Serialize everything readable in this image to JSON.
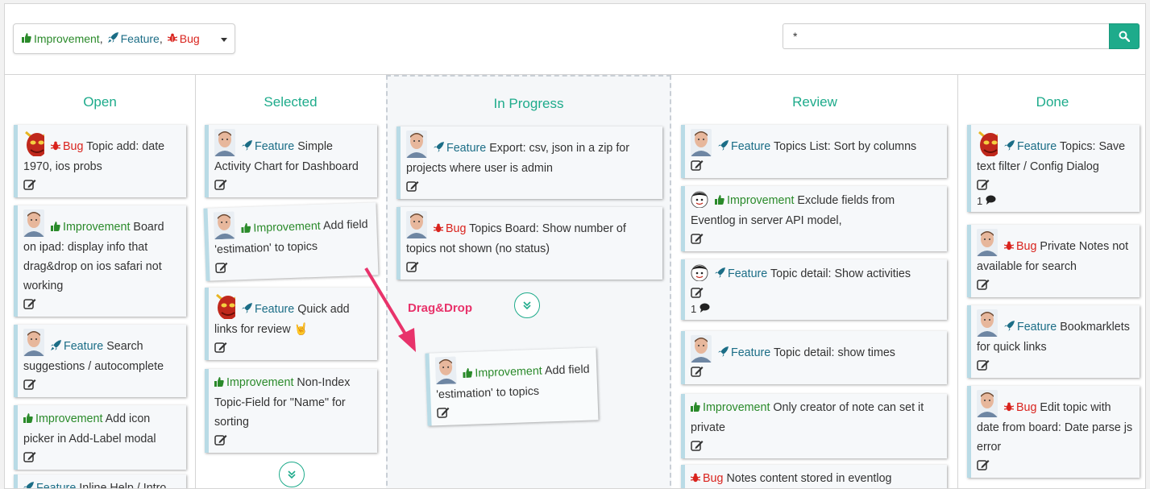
{
  "filter": {
    "types": [
      {
        "label": "Improvement",
        "kind": "improvement"
      },
      {
        "label": "Feature",
        "kind": "feature"
      },
      {
        "label": "Bug",
        "kind": "bug"
      }
    ],
    "separator": ","
  },
  "search": {
    "value": "*"
  },
  "columns": [
    {
      "title": "Open"
    },
    {
      "title": "Selected"
    },
    {
      "title": "In Progress"
    },
    {
      "title": "Review"
    },
    {
      "title": "Done"
    }
  ],
  "cards": {
    "open": [
      {
        "type": "Bug",
        "text": "Topic add: date 1970, ios probs",
        "avatar": "devil-avatar"
      },
      {
        "type": "Improvement",
        "text": "Board on ipad: display info that drag&drop on ios safari not working",
        "avatar": "man-avatar"
      },
      {
        "type": "Feature",
        "text": "Search suggestions / autocomplete",
        "avatar": "man-avatar"
      },
      {
        "type": "Improvement",
        "text": "Add icon picker in Add-Label modal",
        "avatar": ""
      },
      {
        "type": "Feature",
        "text": "Inline Help / Intro",
        "avatar": ""
      }
    ],
    "selected": [
      {
        "type": "Feature",
        "text": "Simple Activity Chart for Dashboard",
        "avatar": "man-avatar"
      },
      {
        "type": "Improvement",
        "text": "Add field 'estimation' to topics",
        "avatar": "man-avatar"
      },
      {
        "type": "Feature",
        "text": "Quick add links for review",
        "emoji": "🤘",
        "avatar": "devil-avatar"
      },
      {
        "type": "Improvement",
        "text": "Non-Index Topic-Field for \"Name\" for sorting",
        "avatar": ""
      }
    ],
    "in_progress": [
      {
        "type": "Feature",
        "text": "Export: csv, json in a zip for projects where user is admin",
        "avatar": "man-avatar"
      },
      {
        "type": "Bug",
        "text": "Topics Board: Show number of topics not shown (no status)",
        "avatar": "man-avatar"
      }
    ],
    "dragged": {
      "type": "Improvement",
      "text": "Add field 'estimation' to topics",
      "avatar": "man-avatar"
    },
    "review": [
      {
        "type": "Feature",
        "text": "Topics List: Sort by columns",
        "avatar": "man-avatar"
      },
      {
        "type": "Improvement",
        "text": "Exclude fields from Eventlog in server API model,",
        "avatar": "cartoon-avatar"
      },
      {
        "type": "Feature",
        "text": "Topic detail: Show activities",
        "avatar": "cartoon-avatar",
        "comments": "1"
      },
      {
        "type": "Feature",
        "text": "Topic detail: show times",
        "avatar": "man-avatar"
      },
      {
        "type": "Improvement",
        "text": "Only creator of note can set it private",
        "avatar": ""
      },
      {
        "type": "Bug",
        "text": "Notes content stored in eventlog",
        "avatar": ""
      }
    ],
    "done": [
      {
        "type": "Feature",
        "text": "Topics: Save text filter / Config Dialog",
        "avatar": "devil-avatar",
        "comments": "1"
      },
      {
        "type": "Bug",
        "text": "Private Notes not available for search",
        "avatar": "man-avatar"
      },
      {
        "type": "Feature",
        "text": "Bookmarklets for quick links",
        "avatar": "man-avatar"
      },
      {
        "type": "Bug",
        "text": "Edit topic with date from board: Date parse js error",
        "avatar": "man-avatar"
      }
    ]
  },
  "drag_label": "Drag&Drop",
  "colors": {
    "accent": "#1eab8b",
    "bug": "#d9231d",
    "improvement": "#2a8a2a",
    "feature": "#1b6d86",
    "drag_arrow": "#e8336b"
  }
}
